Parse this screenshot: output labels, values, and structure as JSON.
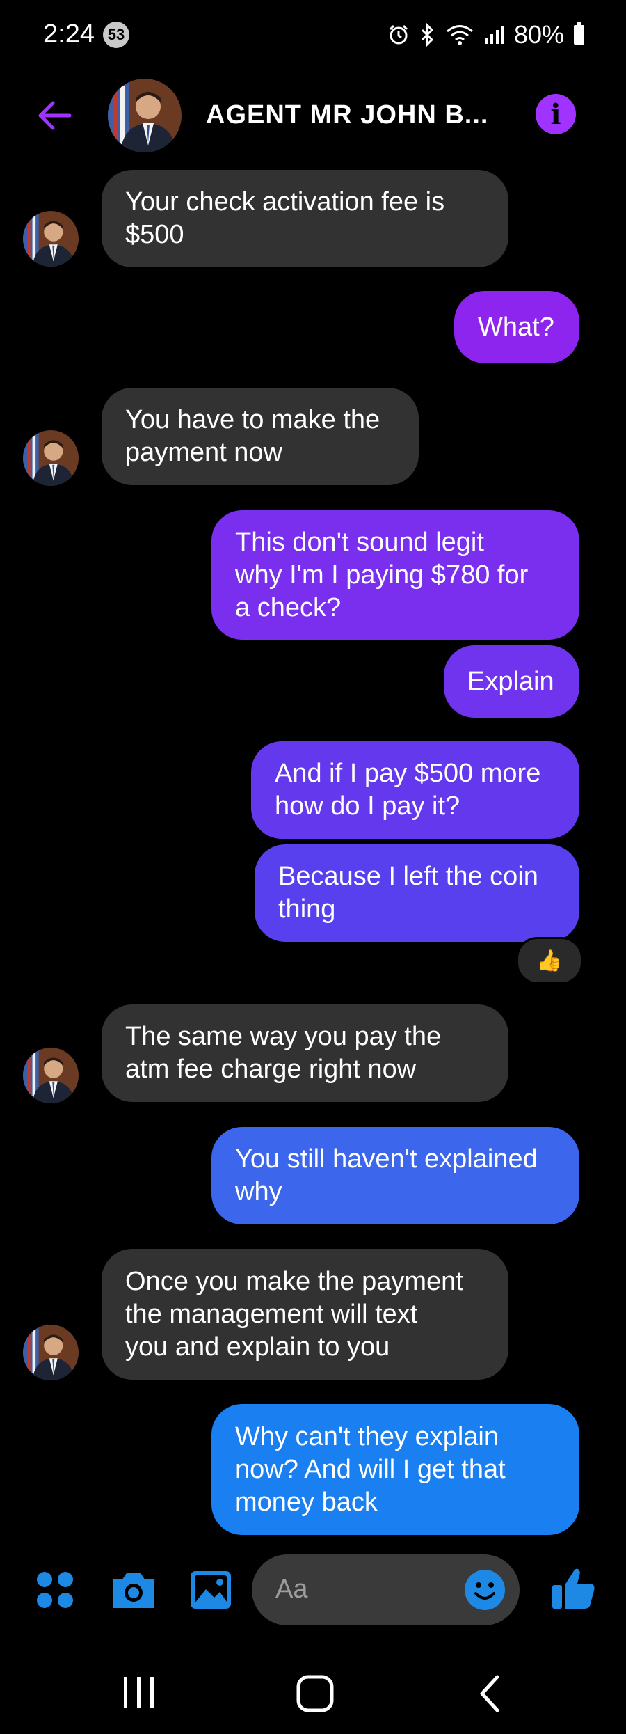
{
  "status_bar": {
    "time": "2:24",
    "notification_count": "53",
    "battery": "80%"
  },
  "header": {
    "contact_name": "AGENT  MR  JOHN  B..."
  },
  "messages": [
    {
      "sender": "them",
      "text_lines": [
        "Your check activation fee is",
        "$500"
      ]
    },
    {
      "sender": "me",
      "text_lines": [
        "What?"
      ]
    },
    {
      "sender": "them",
      "text_lines": [
        "You have to make the",
        "payment now"
      ]
    },
    {
      "sender": "me",
      "text_lines": [
        "This don't sound legit",
        "why I'm I paying $780 for",
        "a check?"
      ]
    },
    {
      "sender": "me",
      "text_lines": [
        "Explain"
      ]
    },
    {
      "sender": "me",
      "text_lines": [
        "And if I pay $500 more",
        "how do I pay it?"
      ]
    },
    {
      "sender": "me",
      "text_lines": [
        "Because I left the coin",
        "thing"
      ],
      "reaction": "👍"
    },
    {
      "sender": "them",
      "text_lines": [
        "The same way you pay the",
        "atm fee charge right now"
      ]
    },
    {
      "sender": "me",
      "text_lines": [
        "You still haven't explained",
        "why"
      ]
    },
    {
      "sender": "them",
      "text_lines": [
        "Once you make the payment",
        "the management will text",
        "you and explain to you"
      ]
    },
    {
      "sender": "me",
      "text_lines": [
        "Why can't they explain",
        "now? And will I get that",
        "money back"
      ]
    }
  ],
  "composer": {
    "placeholder": "Aa"
  },
  "colors": {
    "accent": "#a033ff",
    "incoming_bubble": "#323232",
    "composer_icons": "#1e88e5"
  },
  "icons": {
    "back": "arrow-left-icon",
    "info": "info-icon",
    "apps": "apps-grid-icon",
    "camera": "camera-icon",
    "gallery": "image-icon",
    "emoji": "smiley-icon",
    "like": "thumbs-up-icon",
    "nav_recent": "recent-apps-icon",
    "nav_home": "home-icon",
    "nav_back": "chevron-left-icon"
  }
}
